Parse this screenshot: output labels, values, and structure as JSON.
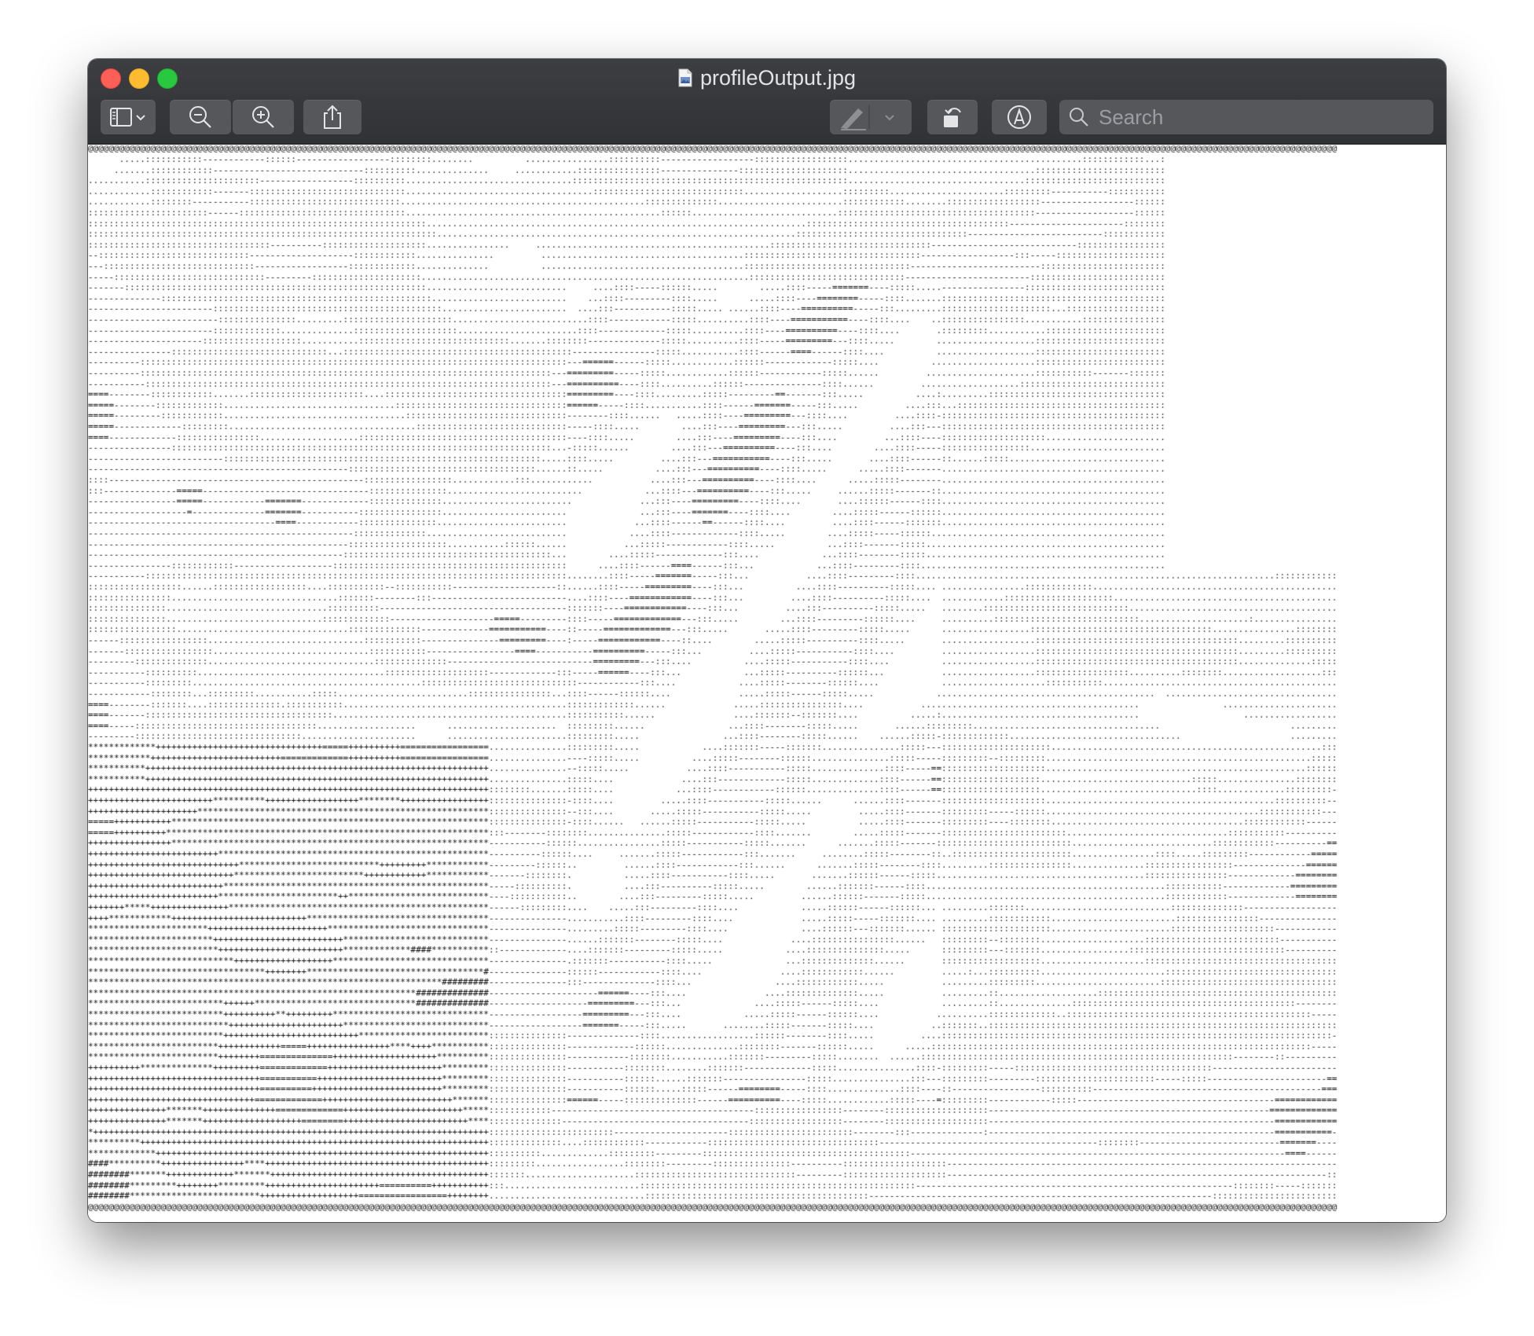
{
  "window": {
    "title": "profileOutput.jpg"
  },
  "toolbar": {
    "sidebar_icon": "sidebar-icon",
    "zoom_out_icon": "zoom-out-icon",
    "zoom_in_icon": "zoom-in-icon",
    "share_icon": "share-icon",
    "markup_icon": "highlighter-icon",
    "rotate_icon": "rotate-left-icon",
    "annotate_icon": "markup-pen-icon",
    "search_icon": "search-icon"
  },
  "search": {
    "placeholder": "Search",
    "value": ""
  },
  "colors": {
    "titlebar": "#37383c",
    "button": "#56575b",
    "close": "#fe5f57",
    "minimize": "#febc2e",
    "maximize": "#28c840"
  },
  "image": {
    "description_alphabet": "@%#*+=-:. ",
    "content_type": "ascii-art"
  }
}
